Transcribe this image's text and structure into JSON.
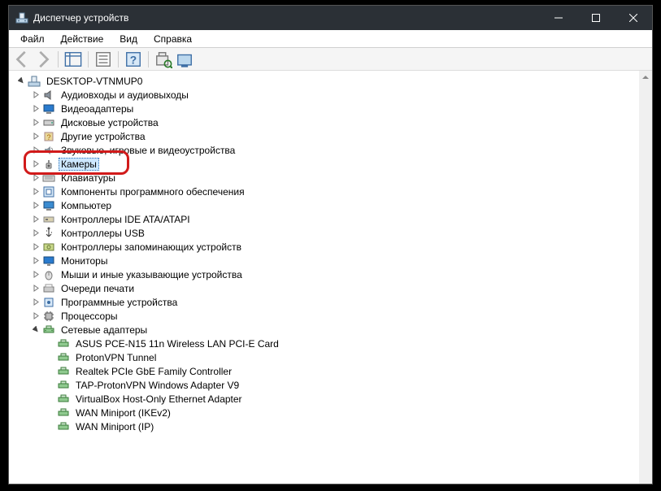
{
  "window": {
    "title": "Диспетчер устройств"
  },
  "menu": {
    "file": "Файл",
    "action": "Действие",
    "view": "Вид",
    "help": "Справка"
  },
  "tree": {
    "root": "DESKTOP-VTNMUP0",
    "categories": [
      {
        "label": "Аудиовходы и аудиовыходы",
        "icon": "audio"
      },
      {
        "label": "Видеоадаптеры",
        "icon": "display"
      },
      {
        "label": "Дисковые устройства",
        "icon": "disk"
      },
      {
        "label": "Другие устройства",
        "icon": "other"
      },
      {
        "label": "Звуковые, игровые и видеоустройства",
        "icon": "sound"
      },
      {
        "label": "Камеры",
        "icon": "camera",
        "selected": true,
        "highlighted": true
      },
      {
        "label": "Клавиатуры",
        "icon": "keyboard"
      },
      {
        "label": "Компоненты программного обеспечения",
        "icon": "software"
      },
      {
        "label": "Компьютер",
        "icon": "computer"
      },
      {
        "label": "Контроллеры IDE ATA/ATAPI",
        "icon": "ide"
      },
      {
        "label": "Контроллеры USB",
        "icon": "usb"
      },
      {
        "label": "Контроллеры запоминающих устройств",
        "icon": "storage"
      },
      {
        "label": "Мониторы",
        "icon": "monitor"
      },
      {
        "label": "Мыши и иные указывающие устройства",
        "icon": "mouse"
      },
      {
        "label": "Очереди печати",
        "icon": "printer"
      },
      {
        "label": "Программные устройства",
        "icon": "softdev"
      },
      {
        "label": "Процессоры",
        "icon": "cpu"
      },
      {
        "label": "Сетевые адаптеры",
        "icon": "network",
        "expanded": true,
        "children": [
          "ASUS PCE-N15 11n Wireless LAN PCI-E Card",
          "ProtonVPN Tunnel",
          "Realtek PCIe GbE Family Controller",
          "TAP-ProtonVPN Windows Adapter V9",
          "VirtualBox Host-Only Ethernet Adapter",
          "WAN Miniport (IKEv2)",
          "WAN Miniport (IP)"
        ]
      }
    ]
  }
}
